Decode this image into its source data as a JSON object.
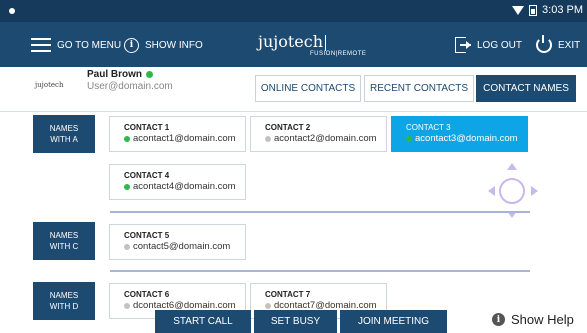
{
  "status_bar": {
    "time": "3:03 PM"
  },
  "nav": {
    "go_to_menu": "GO TO MENU",
    "show_info": "SHOW INFO",
    "brand": "jujotech",
    "brand_sub": "FUSION|REMOTE",
    "log_out": "LOG OUT",
    "exit": "EXIT"
  },
  "user": {
    "logo": "jujotech",
    "name": "Paul Brown",
    "email": "User@domain.com",
    "status": "online"
  },
  "tabs": [
    {
      "label": "ONLINE CONTACTS",
      "active": false
    },
    {
      "label": "RECENT CONTACTS",
      "active": false
    },
    {
      "label": "CONTACT NAMES",
      "active": true
    }
  ],
  "groups": [
    {
      "label_line1": "NAMES",
      "label_line2": "WITH A",
      "contacts": [
        {
          "name": "CONTACT 1",
          "email": "acontact1@domain.com",
          "status": "online",
          "selected": false
        },
        {
          "name": "CONTACT 2",
          "email": "acontact2@domain.com",
          "status": "offline",
          "selected": false
        },
        {
          "name": "CONTACT 3",
          "email": "acontact3@domain.com",
          "status": "online",
          "selected": true
        },
        {
          "name": "CONTACT 4",
          "email": "acontact4@domain.com",
          "status": "online",
          "selected": false
        }
      ]
    },
    {
      "label_line1": "NAMES",
      "label_line2": "WITH C",
      "contacts": [
        {
          "name": "CONTACT 5",
          "email": "contact5@domain.com",
          "status": "offline",
          "selected": false
        }
      ]
    },
    {
      "label_line1": "NAMES",
      "label_line2": "WITH D",
      "contacts": [
        {
          "name": "CONTACT 6",
          "email": "dcontact6@domain.com",
          "status": "offline",
          "selected": false
        },
        {
          "name": "CONTACT 7",
          "email": "dcontact7@domain.com",
          "status": "offline",
          "selected": false
        }
      ]
    }
  ],
  "actions": {
    "start_call": "START CALL",
    "set_busy": "SET BUSY",
    "join_meeting": "JOIN MEETING",
    "show_help": "Show Help"
  },
  "colors": {
    "nav_bg": "#1d4a71",
    "status_bg": "#163a5c",
    "selected_contact": "#0ea5e6",
    "online": "#2fb84a",
    "offline": "#c2c2c2"
  }
}
